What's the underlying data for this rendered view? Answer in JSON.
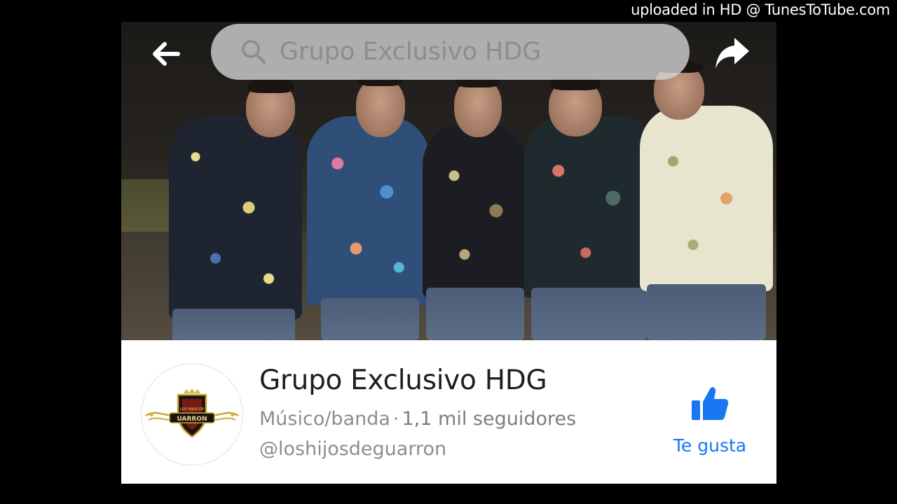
{
  "watermark": "uploaded in HD @ TunesToTube.com",
  "header": {
    "search_text": "Grupo Exclusivo HDG",
    "back_icon": "arrow-left-icon",
    "share_icon": "share-arrow-icon"
  },
  "page": {
    "name": "Grupo Exclusivo HDG",
    "category": "Músico/banda",
    "separator": "·",
    "followers": "1,1 mil seguidores",
    "handle": "@loshijosdeguarron",
    "avatar_logo_text": "LOS HIJOS DE GUARRON"
  },
  "like_button": {
    "label": "Te gusta",
    "icon": "thumbs-up-icon",
    "color": "#1877f2"
  }
}
